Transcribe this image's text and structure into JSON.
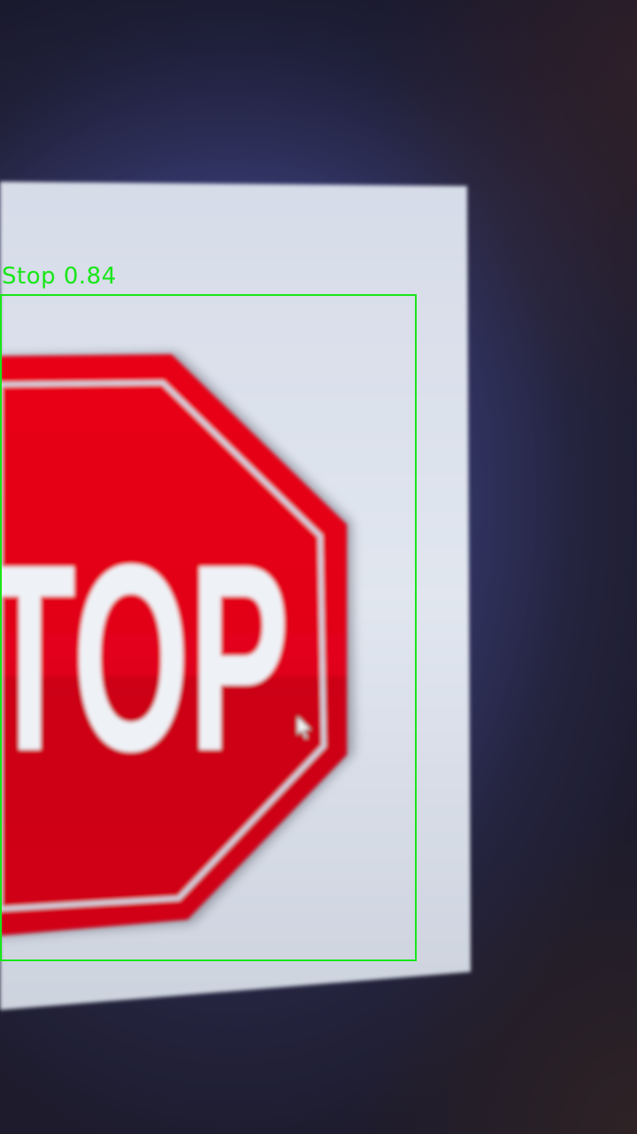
{
  "detection": {
    "label": "Stop",
    "confidence": "0.84",
    "box_color": "#19e619"
  },
  "sign": {
    "visible_text": "TOP",
    "face_color": "#e00016",
    "border_color": "#d0d8e4",
    "text_color": "#eef2f6"
  },
  "colors": {
    "background": "#34376a",
    "screen": "#dfe5ee"
  }
}
